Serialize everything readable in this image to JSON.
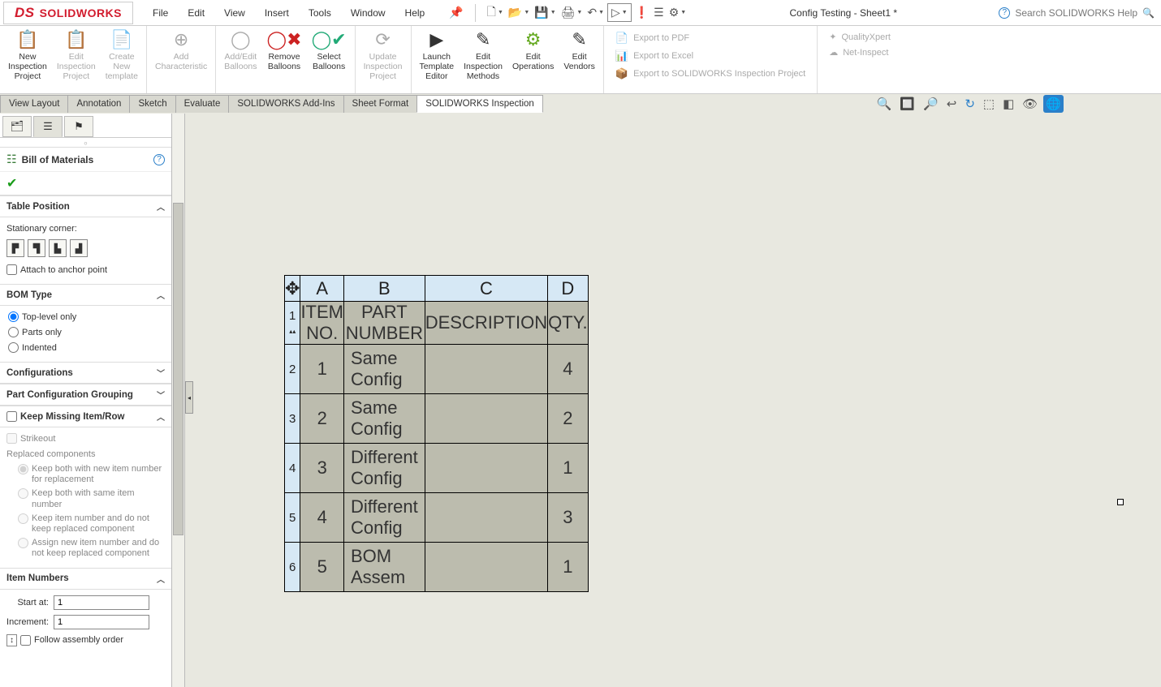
{
  "logo_text": "SOLIDWORKS",
  "menu": {
    "file": "File",
    "edit": "Edit",
    "view": "View",
    "insert": "Insert",
    "tools": "Tools",
    "window": "Window",
    "help": "Help"
  },
  "doc_title": "Config Testing - Sheet1 *",
  "search_placeholder": "Search SOLIDWORKS Help",
  "ribbon": {
    "new_inspection": "New\nInspection\nProject",
    "edit_inspection": "Edit\nInspection\nProject",
    "create_template": "Create\nNew\ntemplate",
    "add_char": "Add\nCharacteristic",
    "addedit_balloons": "Add/Edit\nBalloons",
    "remove_balloons": "Remove\nBalloons",
    "select_balloons": "Select\nBalloons",
    "update_project": "Update\nInspection\nProject",
    "launch_template": "Launch\nTemplate\nEditor",
    "edit_methods": "Edit\nInspection\nMethods",
    "edit_ops": "Edit\nOperations",
    "edit_vendors": "Edit\nVendors",
    "export_pdf": "Export to PDF",
    "export_excel": "Export to Excel",
    "export_swip": "Export to SOLIDWORKS Inspection Project",
    "qualityxpert": "QualityXpert",
    "netinspect": "Net-Inspect"
  },
  "tabs": {
    "view_layout": "View Layout",
    "annotation": "Annotation",
    "sketch": "Sketch",
    "evaluate": "Evaluate",
    "addins": "SOLIDWORKS Add-Ins",
    "sheet_format": "Sheet Format",
    "inspection": "SOLIDWORKS Inspection"
  },
  "panel": {
    "title": "Bill of Materials",
    "table_position": "Table Position",
    "stationary": "Stationary corner:",
    "attach": "Attach to anchor point",
    "bom_type": "BOM Type",
    "top_level": "Top-level only",
    "parts_only": "Parts only",
    "indented": "Indented",
    "configurations": "Configurations",
    "part_config": "Part Configuration Grouping",
    "keep_missing": "Keep Missing Item/Row",
    "strikeout": "Strikeout",
    "replaced": "Replaced components",
    "repl_a": "Keep both with new item number for replacement",
    "repl_b": "Keep both with same item number",
    "repl_c": "Keep item number and do not keep replaced component",
    "repl_d": "Assign new item number and do not keep replaced component",
    "item_numbers": "Item Numbers",
    "start_at": "Start at:",
    "start_val": "1",
    "increment": "Increment:",
    "increment_val": "1",
    "follow": "Follow assembly order"
  },
  "bom": {
    "col_letters": [
      "A",
      "B",
      "C",
      "D"
    ],
    "headers": {
      "item": "ITEM NO.",
      "part": "PART NUMBER",
      "desc": "DESCRIPTION",
      "qty": "QTY."
    },
    "rows": [
      {
        "n": "1",
        "item": "1",
        "part": "Same Config",
        "desc": "",
        "qty": "4"
      },
      {
        "n": "2",
        "item": "2",
        "part": "Same Config",
        "desc": "",
        "qty": "2"
      },
      {
        "n": "3",
        "item": "3",
        "part": "Different Config",
        "desc": "",
        "qty": "1"
      },
      {
        "n": "4",
        "item": "4",
        "part": "Different Config",
        "desc": "",
        "qty": "3"
      },
      {
        "n": "5",
        "item": "5",
        "part": "BOM Assem",
        "desc": "",
        "qty": "1"
      }
    ]
  }
}
